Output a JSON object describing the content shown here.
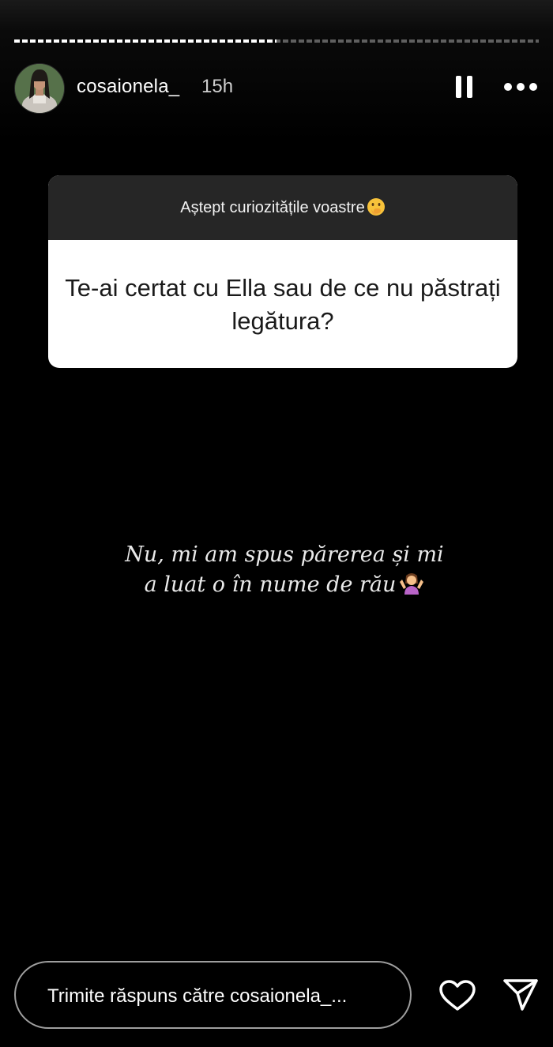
{
  "story": {
    "progress_fraction": 0.5,
    "user": {
      "username": "cosaionela_",
      "time_ago": "15h",
      "avatar_icon": "profile-photo"
    },
    "controls": {
      "pause_icon": "pause-icon",
      "more_icon": "more-options-icon"
    }
  },
  "question_sticker": {
    "prompt": "Aștept curiozitățile voastre",
    "prompt_emoji": "face-with-hand-over-mouth-emoji",
    "question": "Te-ai certat cu Ella sau de ce nu păstrați legătura?"
  },
  "answer": {
    "line1": "Nu, mi am spus părerea și mi",
    "line2": "a luat o în nume de rău",
    "emoji": "person-shrugging-emoji"
  },
  "footer": {
    "reply_placeholder": "Trimite răspuns către cosaionela_...",
    "like_icon": "heart-icon",
    "send_icon": "send-icon"
  },
  "colors": {
    "background": "#000000",
    "sticker_header": "#262626",
    "sticker_body": "#ffffff",
    "text_primary": "#ffffff"
  }
}
